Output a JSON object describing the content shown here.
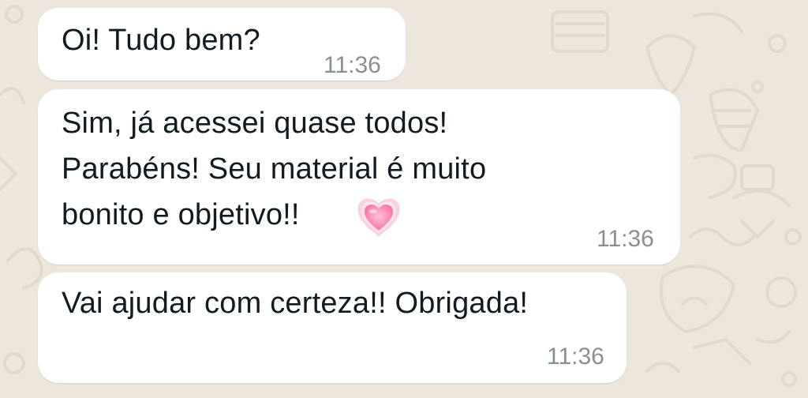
{
  "colors": {
    "wallpaper": "#ede6dd",
    "bubble": "#ffffff",
    "text": "#111b21",
    "timestamp": "#8a8f93",
    "heart": "#f76ca3"
  },
  "messages": [
    {
      "text": "Oi! Tudo bem?",
      "time": "11:36"
    },
    {
      "lines": [
        "Sim, já acessei quase todos!",
        "Parabéns! Seu material é muito",
        "bonito e objetivo!!"
      ],
      "emoji": "growing-heart-icon",
      "time": "11:36"
    },
    {
      "text": "Vai ajudar com certeza!! Obrigada!",
      "time": "11:36"
    }
  ]
}
